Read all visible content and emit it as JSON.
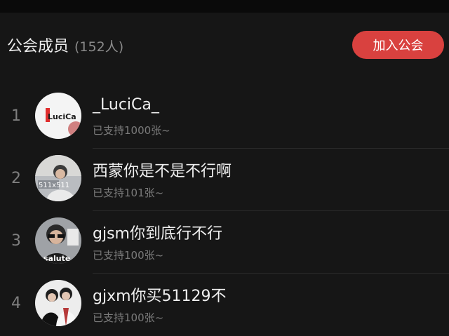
{
  "header": {
    "title": "公会成员",
    "member_count": "(152人)",
    "join_button_label": "加入公会"
  },
  "members": [
    {
      "rank": "1",
      "name": "_LuciCa_",
      "support": "已支持1000张~",
      "avatar_icon": "luci-ca-logo",
      "avatar_text": "LuciCa"
    },
    {
      "rank": "2",
      "name": "西蒙你是不是不行啊",
      "support": "已支持101张~",
      "avatar_icon": "person-photo",
      "avatar_text": "511x511"
    },
    {
      "rank": "3",
      "name": "gjsm你到底行不行",
      "support": "已支持100张~",
      "avatar_icon": "person-sunglasses-photo",
      "avatar_text": "salute"
    },
    {
      "rank": "4",
      "name": "gjxm你买51129不",
      "support": "已支持100张~",
      "avatar_icon": "couple-photo"
    }
  ],
  "colors": {
    "background": "#161616",
    "accent": "#d9413f",
    "primary_text": "#efefef",
    "secondary_text": "#7b7b7b"
  }
}
